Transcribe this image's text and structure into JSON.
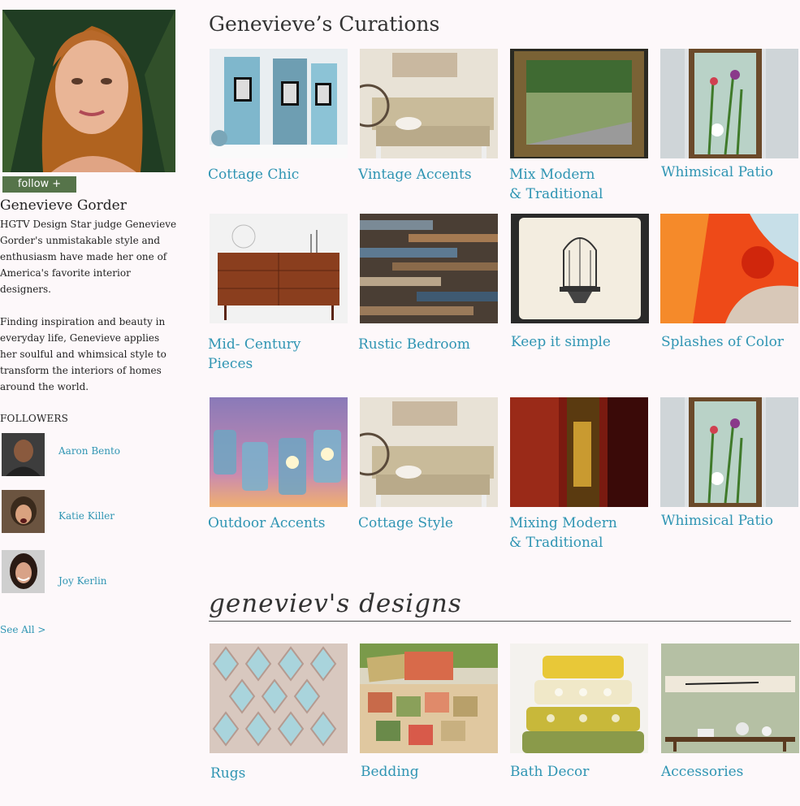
{
  "profile": {
    "name": "Genevieve Gorder",
    "follow_label": "follow +",
    "bio": [
      "HGTV Design Star judge Genevieve Gorder's unmistakable style and enthusiasm have made her one of America's favorite interior designers.",
      "Finding inspiration and beauty in everyday life, Genevieve applies her soulful and whimsical style to transform the interiors of homes around the world."
    ]
  },
  "followers": {
    "heading": "FOLLOWERS",
    "items": [
      {
        "name": "Aaron Bento"
      },
      {
        "name": "Katie Killer"
      },
      {
        "name": "Joy Kerlin"
      }
    ],
    "see_all": "See All >"
  },
  "curations": {
    "title": "Genevieve’s Curations",
    "items": [
      {
        "caption": "Cottage Chic"
      },
      {
        "caption": "Vintage Accents"
      },
      {
        "caption": "Mix Modern\n& Traditional"
      },
      {
        "caption": "Whimsical Patio"
      },
      {
        "caption": "Mid- Century\nPieces"
      },
      {
        "caption": "Rustic Bedroom"
      },
      {
        "caption": "Keep it simple"
      },
      {
        "caption": "Splashes of Color"
      },
      {
        "caption": "Outdoor Accents"
      },
      {
        "caption": "Cottage Style"
      },
      {
        "caption": "Mixing Modern\n& Traditional"
      },
      {
        "caption": "Whimsical Patio"
      }
    ]
  },
  "designs": {
    "title": "geneviev's designs",
    "items": [
      {
        "caption": "Rugs"
      },
      {
        "caption": "Bedding"
      },
      {
        "caption": "Bath Decor"
      },
      {
        "caption": "Accessories"
      }
    ]
  },
  "colors": {
    "link": "#2f95b3",
    "follow_button": "#56744a",
    "background": "#fdf8fa"
  }
}
